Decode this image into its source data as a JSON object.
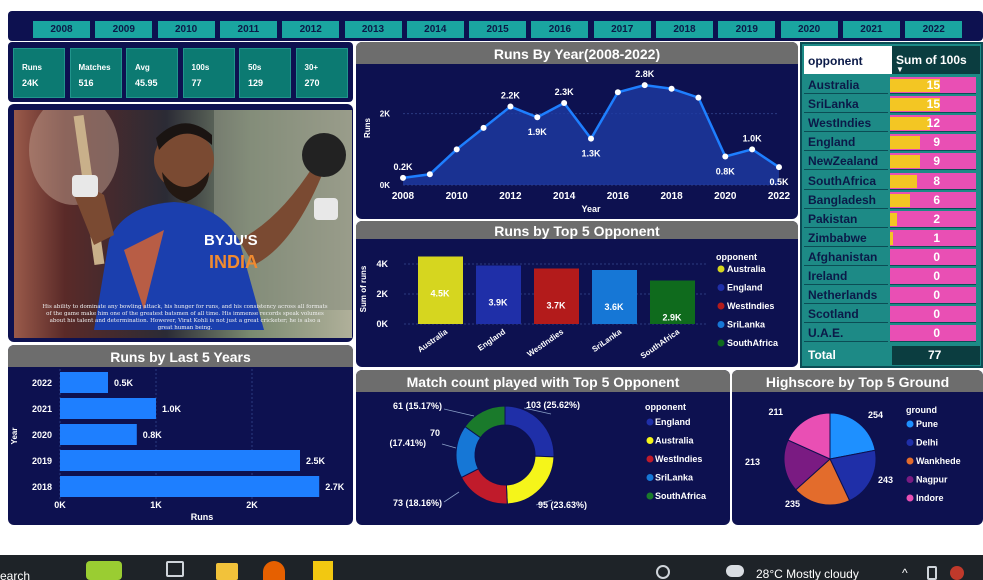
{
  "years": [
    "2008",
    "2009",
    "2010",
    "2011",
    "2012",
    "2013",
    "2014",
    "2015",
    "2016",
    "2017",
    "2018",
    "2019",
    "2020",
    "2021",
    "2022"
  ],
  "cards": [
    {
      "label": "Runs",
      "value": "24K"
    },
    {
      "label": "Matches",
      "value": "516"
    },
    {
      "label": "Avg",
      "value": "45.95"
    },
    {
      "label": "100s",
      "value": "77"
    },
    {
      "label": "50s",
      "value": "129"
    },
    {
      "label": "30+",
      "value": "270"
    }
  ],
  "player": {
    "jersey_logo": "BYJU'S",
    "jersey_country": "INDIA",
    "bio": "His ability to dominate any bowling attack, his hunger for runs, and his consistency across all formats of the game make him one of the greatest batsmen of all time. His immense records speak volumes about his talent and determination. However, Virat Kohli is not just a great cricketer; he is also a great human being."
  },
  "runs_by_year": {
    "title": "Runs By Year(2008-2022)",
    "ylabel": "Runs",
    "xlabel": "Year",
    "yticks": [
      "0K",
      "2K"
    ],
    "xticks": [
      "2008",
      "2010",
      "2012",
      "2014",
      "2016",
      "2018",
      "2020",
      "2022"
    ],
    "labels": [
      {
        "year": "2008",
        "text": "0.2K"
      },
      {
        "year": "2012",
        "text": "2.2K"
      },
      {
        "year": "2013",
        "text": "1.9K"
      },
      {
        "year": "2014",
        "text": "2.3K"
      },
      {
        "year": "2015",
        "text": "1.3K"
      },
      {
        "year": "2017",
        "text": "2.8K"
      },
      {
        "year": "2020",
        "text": "0.8K"
      },
      {
        "year": "2021",
        "text": "1.0K"
      },
      {
        "year": "2022",
        "text": "0.5K"
      }
    ]
  },
  "top5_opponent": {
    "title": "Runs by Top 5 Opponent",
    "ylabel": "Sum of runs",
    "yticks": [
      "0K",
      "2K",
      "4K"
    ],
    "legend_title": "opponent"
  },
  "last5": {
    "title": "Runs by Last 5 Years",
    "ylabel": "Year",
    "xlabel": "Runs",
    "xticks": [
      "0K",
      "1K",
      "2K"
    ]
  },
  "match_count": {
    "title": "Match count played with Top 5 Opponent",
    "legend_title": "opponent",
    "labels": [
      "103 (25.62%)",
      "95 (23.63%)",
      "73 (18.16%)",
      "70",
      "(17.41%)",
      "61 (15.17%)"
    ]
  },
  "highscore": {
    "title": "Highscore by Top 5 Ground",
    "legend_title": "ground",
    "labels": [
      "254",
      "243",
      "235",
      "213",
      "211"
    ]
  },
  "hundreds_table": {
    "col1": "opponent",
    "col2": "Sum of 100s",
    "rows": [
      {
        "name": "Australia",
        "value": "15"
      },
      {
        "name": "SriLanka",
        "value": "15"
      },
      {
        "name": "WestIndies",
        "value": "12"
      },
      {
        "name": "England",
        "value": "9"
      },
      {
        "name": "NewZealand",
        "value": "9"
      },
      {
        "name": "SouthAfrica",
        "value": "8"
      },
      {
        "name": "Bangladesh",
        "value": "6"
      },
      {
        "name": "Pakistan",
        "value": "2"
      },
      {
        "name": "Zimbabwe",
        "value": "1"
      },
      {
        "name": "Afghanistan",
        "value": "0"
      },
      {
        "name": "Ireland",
        "value": "0"
      },
      {
        "name": "Netherlands",
        "value": "0"
      },
      {
        "name": "Scotland",
        "value": "0"
      },
      {
        "name": "U.A.E.",
        "value": "0"
      }
    ],
    "total_label": "Total",
    "total_value": "77"
  },
  "taskbar": {
    "search": "earch",
    "weather": "28°C  Mostly cloudy"
  },
  "chart_data": [
    {
      "type": "area",
      "title": "Runs By Year(2008-2022)",
      "xlabel": "Year",
      "ylabel": "Runs",
      "x": [
        2008,
        2009,
        2010,
        2011,
        2012,
        2013,
        2014,
        2015,
        2016,
        2017,
        2018,
        2019,
        2020,
        2021,
        2022
      ],
      "values": [
        0.2,
        0.3,
        1.0,
        1.6,
        2.2,
        1.9,
        2.3,
        1.3,
        2.6,
        2.8,
        2.7,
        2.45,
        0.8,
        1.0,
        0.5
      ],
      "ylim": [
        0,
        3
      ]
    },
    {
      "type": "bar",
      "title": "Runs by Top 5 Opponent",
      "ylabel": "Sum of runs",
      "categories": [
        "Australia",
        "England",
        "WestIndies",
        "SriLanka",
        "SouthAfrica"
      ],
      "values": [
        4.5,
        3.9,
        3.7,
        3.6,
        2.9
      ],
      "value_labels": [
        "4.5K",
        "3.9K",
        "3.7K",
        "3.6K",
        "2.9K"
      ],
      "colors": [
        "#d6d61f",
        "#1f2fa8",
        "#b31b1b",
        "#1677d6",
        "#0f6b1d"
      ],
      "ylim": [
        0,
        5
      ]
    },
    {
      "type": "bar",
      "title": "Runs by Last 5 Years",
      "xlabel": "Runs",
      "ylabel": "Year",
      "categories": [
        "2022",
        "2021",
        "2020",
        "2019",
        "2018"
      ],
      "values": [
        0.5,
        1.0,
        0.8,
        2.5,
        2.7
      ],
      "value_labels": [
        "0.5K",
        "1.0K",
        "0.8K",
        "2.5K",
        "2.7K"
      ],
      "xlim": [
        0,
        3
      ]
    },
    {
      "type": "pie",
      "title": "Match count played with Top 5 Opponent",
      "categories": [
        "England",
        "Australia",
        "WestIndies",
        "SriLanka",
        "SouthAfrica"
      ],
      "values": [
        103,
        95,
        73,
        70,
        61
      ],
      "colors": [
        "#1f2fa8",
        "#f5f51a",
        "#c01b2b",
        "#1677d6",
        "#1a7a2b"
      ]
    },
    {
      "type": "pie",
      "title": "Highscore by Top 5 Ground",
      "categories": [
        "Pune",
        "Delhi",
        "Wankhede",
        "Nagpur",
        "Indore"
      ],
      "values": [
        254,
        243,
        235,
        213,
        211
      ],
      "colors": [
        "#1e90ff",
        "#1f2fa8",
        "#e36c2c",
        "#7a1b82",
        "#e94fb4"
      ]
    },
    {
      "type": "table",
      "title": "Sum of 100s by opponent",
      "categories": [
        "Australia",
        "SriLanka",
        "WestIndies",
        "England",
        "NewZealand",
        "SouthAfrica",
        "Bangladesh",
        "Pakistan",
        "Zimbabwe",
        "Afghanistan",
        "Ireland",
        "Netherlands",
        "Scotland",
        "U.A.E."
      ],
      "values": [
        15,
        15,
        12,
        9,
        9,
        8,
        6,
        2,
        1,
        0,
        0,
        0,
        0,
        0
      ],
      "total": 77
    }
  ]
}
